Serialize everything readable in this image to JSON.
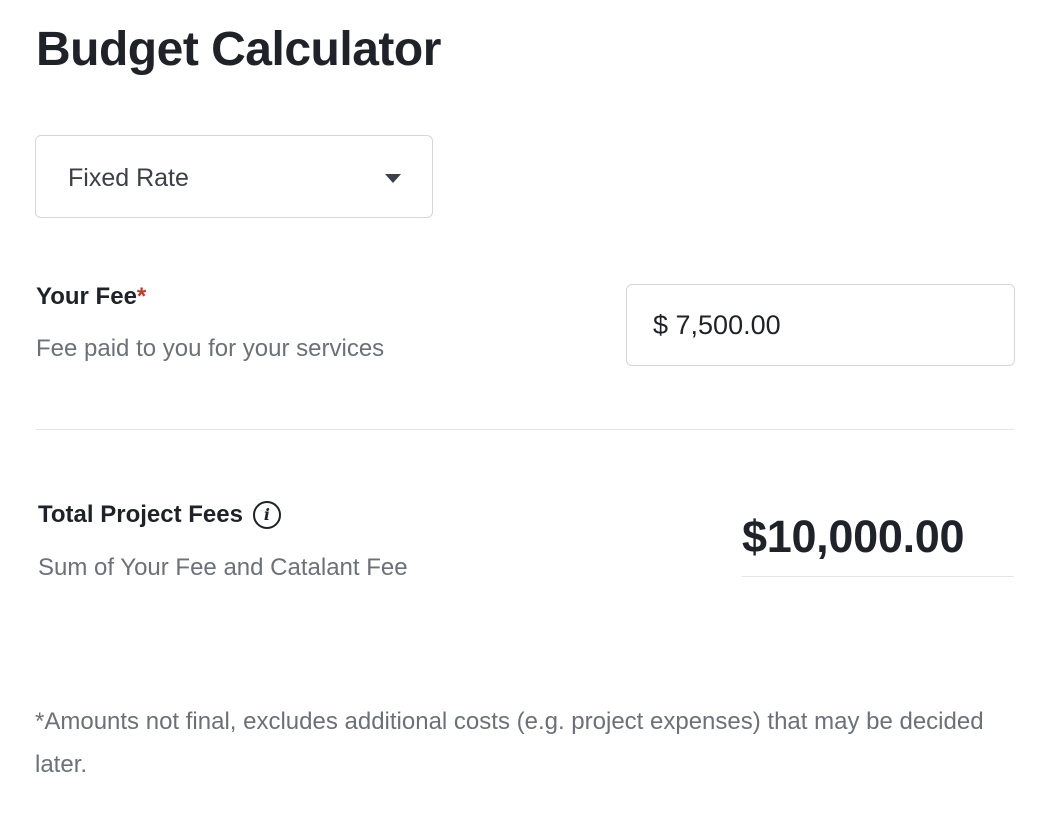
{
  "page": {
    "title": "Budget Calculator"
  },
  "rate_type": {
    "selected": "Fixed Rate",
    "caret_icon": "caret-down-icon"
  },
  "your_fee": {
    "label": "Your Fee",
    "required_mark": "*",
    "description": "Fee paid to you for your services",
    "value": "$ 7,500.00"
  },
  "total": {
    "label": "Total Project Fees",
    "info_icon": "info-icon",
    "info_glyph": "i",
    "description": "Sum of Your Fee and Catalant Fee",
    "value": "$10,000.00"
  },
  "disclaimer": "*Amounts not final, excludes additional costs (e.g. project expenses) that may be decided later.",
  "colors": {
    "text_primary": "#1f2329",
    "text_secondary": "#6b7079",
    "required": "#c0392b",
    "border": "#d3d7dc",
    "divider": "#e3e5e8"
  }
}
